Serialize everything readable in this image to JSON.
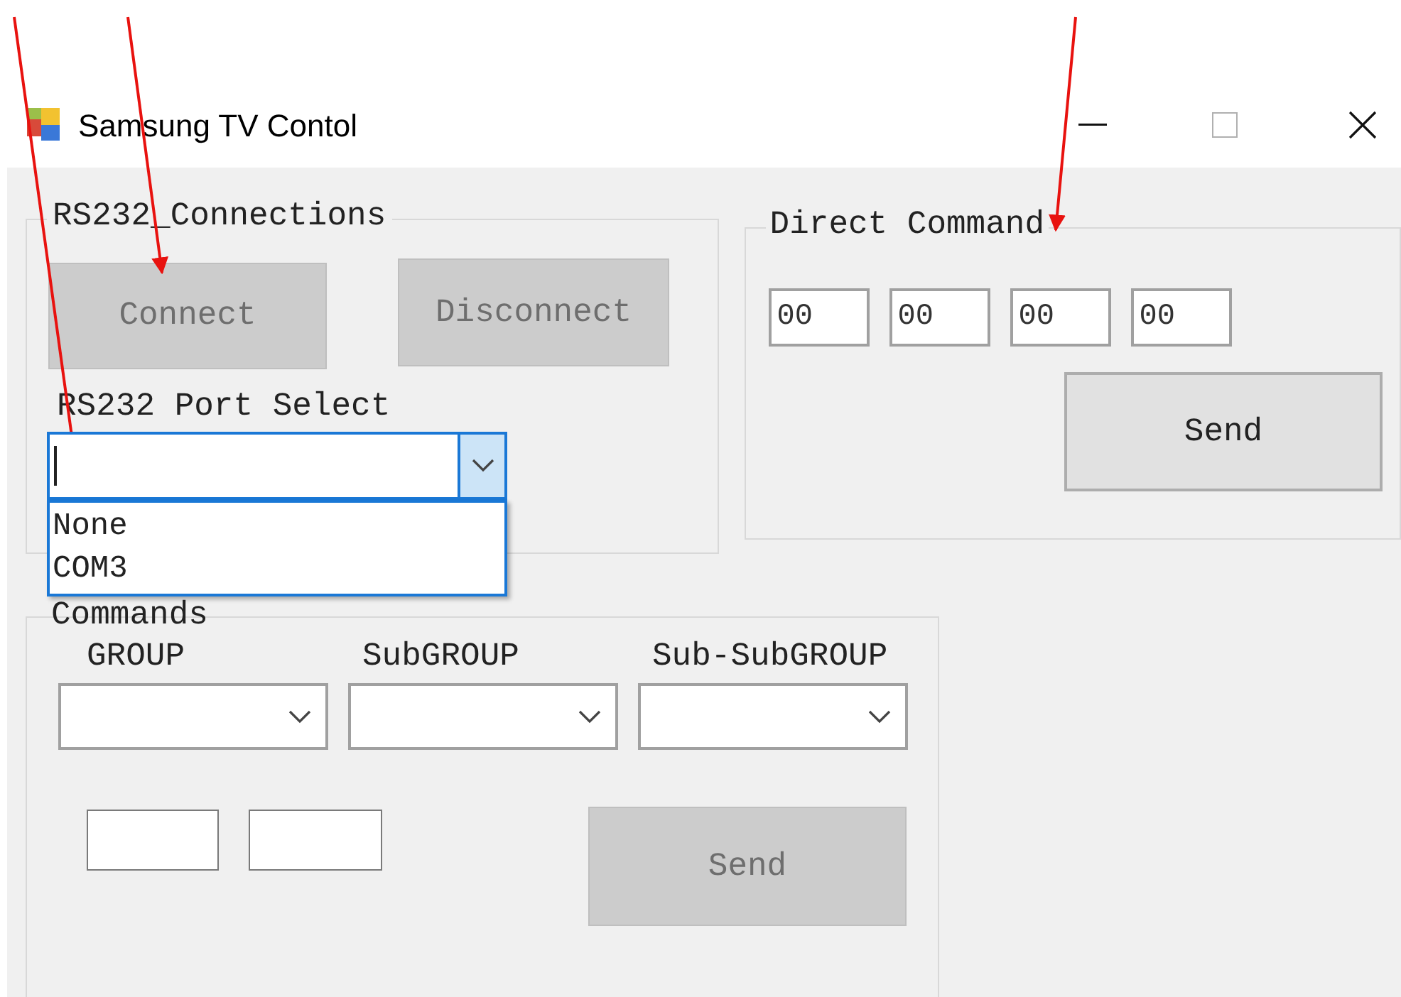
{
  "window": {
    "title": "Samsung TV Contol"
  },
  "rs232_connections": {
    "title": "RS232_Connections",
    "buttons": [
      {
        "label": "Connect",
        "disabled": true
      },
      {
        "label": "Disconnect",
        "disabled": true
      }
    ],
    "port_label": "RS232 Port Select",
    "port_combo": {
      "expanded": true,
      "options": [
        {
          "label": "None"
        },
        {
          "label": "COM3"
        }
      ]
    }
  },
  "direct_command": {
    "title": "Direct Command",
    "fields": [
      {
        "value": "00"
      },
      {
        "value": "00"
      },
      {
        "value": "00"
      },
      {
        "value": "00"
      }
    ],
    "send": {
      "label": "Send",
      "disabled": false
    }
  },
  "commands": {
    "title": "Commands",
    "selectors": [
      {
        "label": "GROUP"
      },
      {
        "label": "SubGROUP"
      },
      {
        "label": "Sub-SubGROUP"
      }
    ],
    "send": {
      "label": "Send",
      "disabled": true
    }
  }
}
